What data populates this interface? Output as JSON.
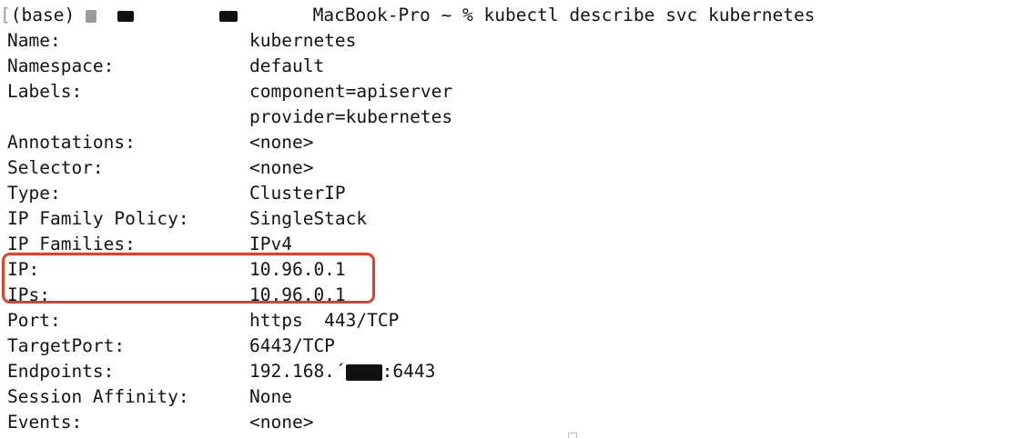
{
  "prompt": {
    "bracket": "[",
    "env": "(base)",
    "host": "MacBook-Pro",
    "cwd": "~",
    "symbol": "%",
    "command": "kubectl describe svc kubernetes"
  },
  "rows": [
    {
      "key": "Name:",
      "value": "kubernetes"
    },
    {
      "key": "Namespace:",
      "value": "default"
    },
    {
      "key": "Labels:",
      "value": "component=apiserver"
    },
    {
      "key": "",
      "value": "provider=kubernetes"
    },
    {
      "key": "Annotations:",
      "value": "<none>"
    },
    {
      "key": "Selector:",
      "value": "<none>"
    },
    {
      "key": "Type:",
      "value": "ClusterIP"
    },
    {
      "key": "IP Family Policy:",
      "value": "SingleStack"
    },
    {
      "key": "IP Families:",
      "value": "IPv4"
    },
    {
      "key": "IP:",
      "value": "10.96.0.1"
    },
    {
      "key": "IPs:",
      "value": "10.96.0.1"
    },
    {
      "key": "Port:",
      "value": "https  443/TCP"
    },
    {
      "key": "TargetPort:",
      "value": "6443/TCP"
    },
    {
      "key": "Endpoints:",
      "value_prefix": "192.168.´",
      "value_suffix": ":6443"
    },
    {
      "key": "Session Affinity:",
      "value": "None"
    },
    {
      "key": "Events:",
      "value": "<none>"
    }
  ],
  "colors": {
    "text": "#141414",
    "highlight": "#e0402a",
    "background": "#ffffff"
  }
}
